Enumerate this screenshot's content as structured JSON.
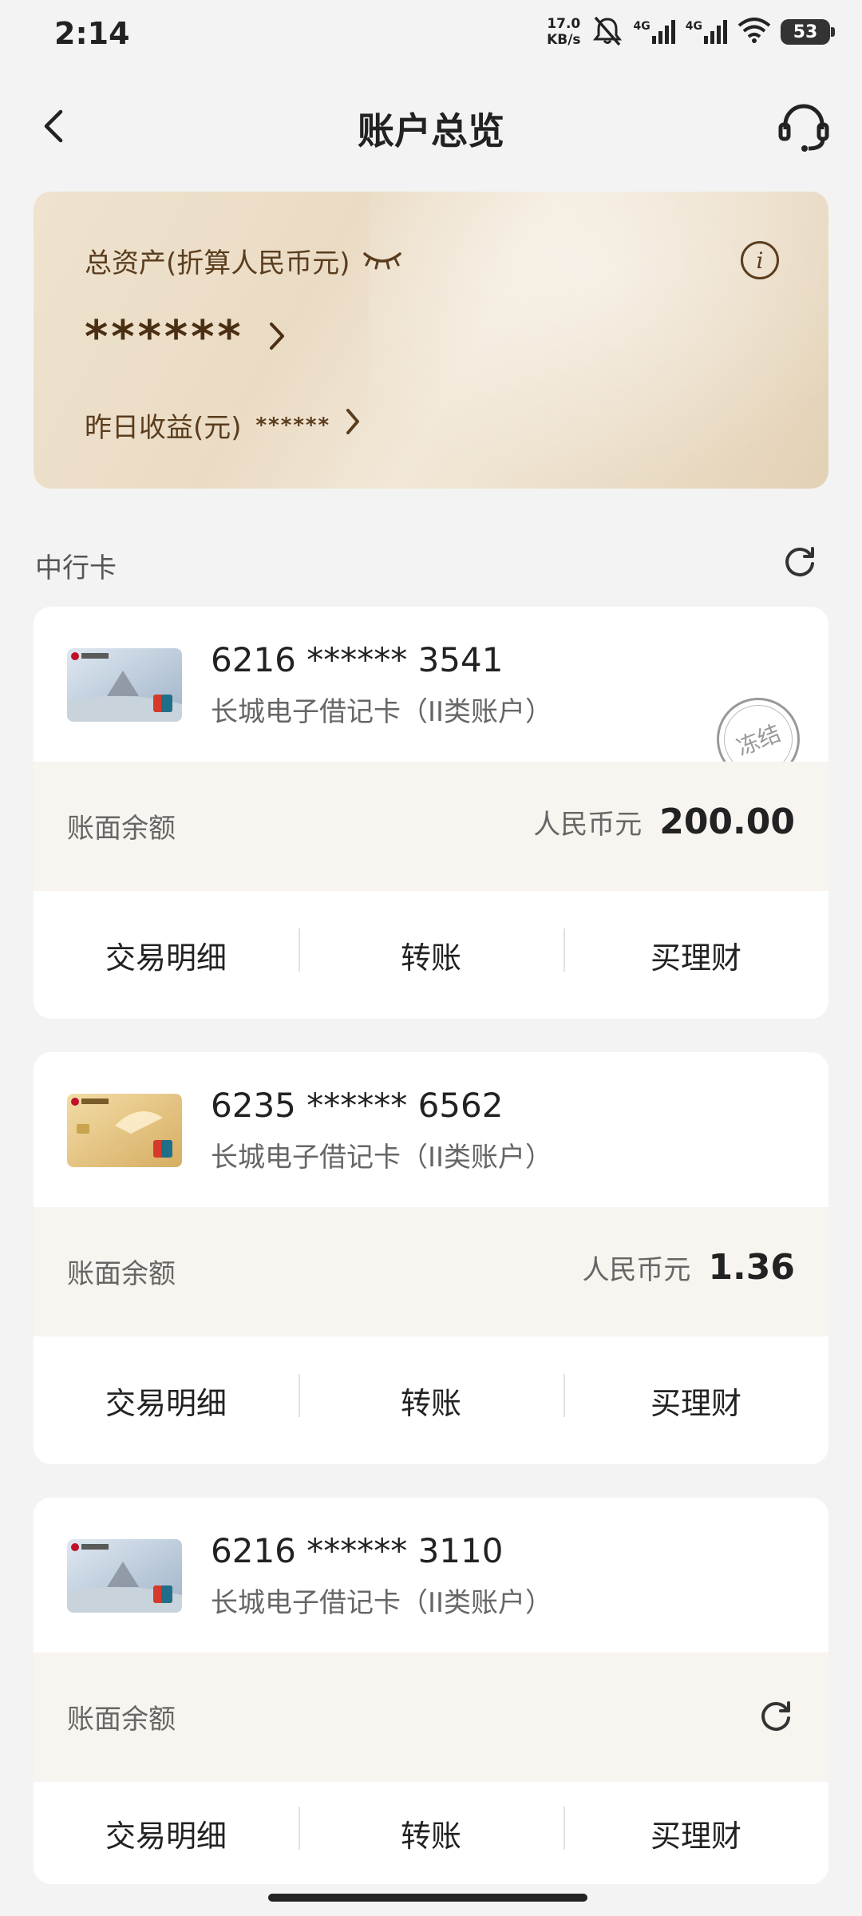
{
  "status_bar": {
    "time": "2:14",
    "net_speed_value": "17.0",
    "net_speed_unit": "KB/s",
    "signal1_label": "4G",
    "signal2_label": "4G",
    "battery": "53"
  },
  "header": {
    "title": "账户总览"
  },
  "assets": {
    "label": "总资产(折算人民币元)",
    "value_masked": "******",
    "yesterday_label": "昨日收益(元)",
    "yesterday_masked": "******"
  },
  "section": {
    "title": "中行卡"
  },
  "cards": [
    {
      "number": "6216 ****** 3541",
      "type": "长城电子借记卡（II类账户）",
      "status": "冻结",
      "balance_label": "账面余额",
      "currency": "人民币元",
      "balance": "200.00",
      "actions": [
        "交易明细",
        "转账",
        "买理财"
      ]
    },
    {
      "number": "6235 ****** 6562",
      "type": "长城电子借记卡（II类账户）",
      "balance_label": "账面余额",
      "currency": "人民币元",
      "balance": "1.36",
      "actions": [
        "交易明细",
        "转账",
        "买理财"
      ]
    },
    {
      "number": "6216 ****** 3110",
      "type": "长城电子借记卡（II类账户）",
      "balance_label": "账面余额",
      "actions": [
        "交易明细",
        "转账",
        "买理财"
      ]
    }
  ],
  "colors": {
    "accent_brown": "#5a3d1e",
    "card_bg": "#ffffff",
    "balance_bg": "#f8f4ef"
  }
}
